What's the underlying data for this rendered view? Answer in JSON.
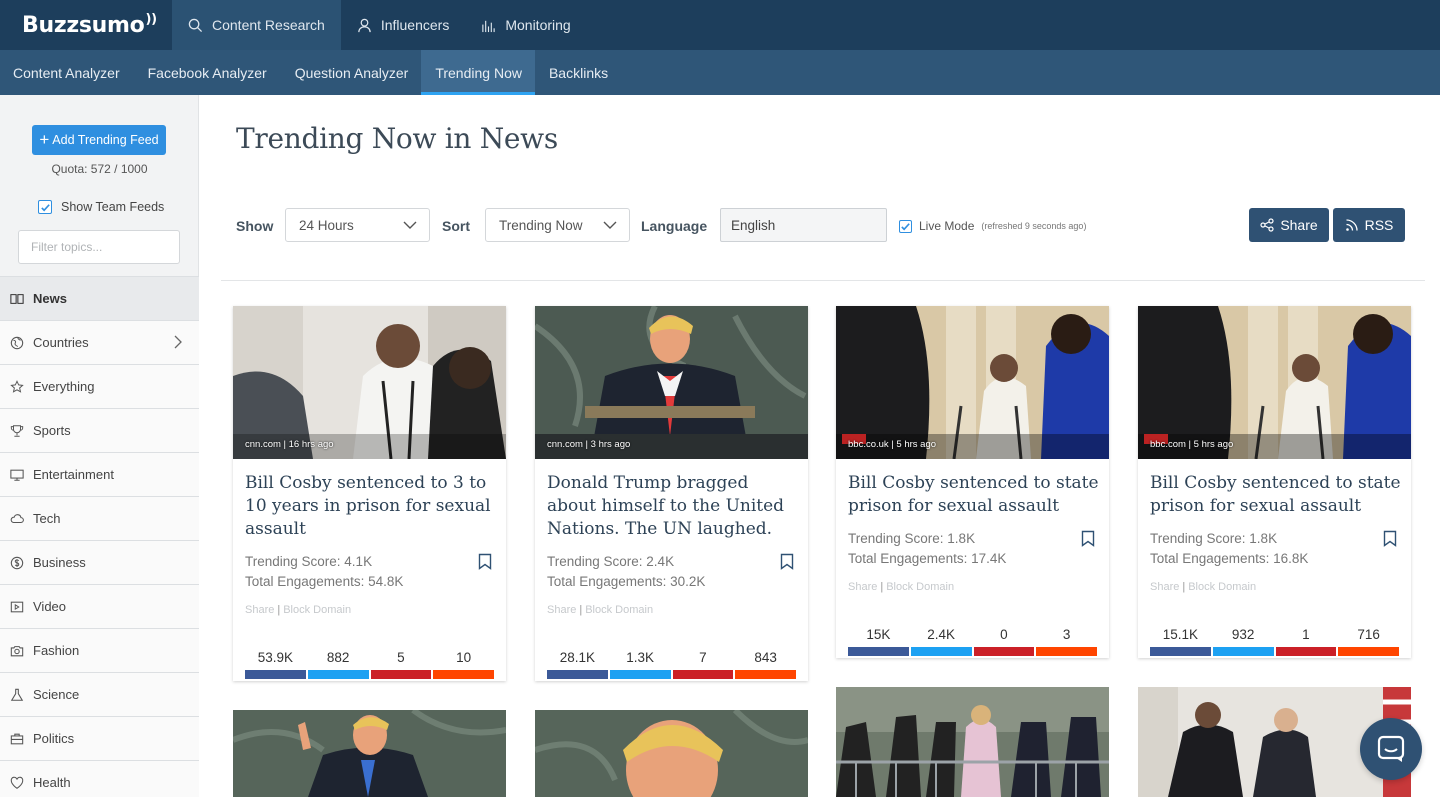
{
  "app": {
    "logo": "Buzzsumo",
    "top_nav": [
      {
        "label": "Content Research",
        "icon": "search-icon",
        "active": true
      },
      {
        "label": "Influencers",
        "icon": "user-icon",
        "active": false
      },
      {
        "label": "Monitoring",
        "icon": "bar-chart-icon",
        "active": false
      }
    ],
    "sub_nav": [
      {
        "label": "Content Analyzer",
        "active": false
      },
      {
        "label": "Facebook Analyzer",
        "active": false
      },
      {
        "label": "Question Analyzer",
        "active": false
      },
      {
        "label": "Trending Now",
        "active": true
      },
      {
        "label": "Backlinks",
        "active": false
      }
    ]
  },
  "sidebar": {
    "add_button": "Add Trending Feed",
    "quota": "Quota: 572 / 1000",
    "show_team_feeds": {
      "label": "Show Team Feeds",
      "checked": true
    },
    "filter_placeholder": "Filter topics...",
    "topics": [
      {
        "label": "News",
        "icon": "book-icon",
        "active": true
      },
      {
        "label": "Countries",
        "icon": "globe-icon",
        "active": false,
        "has_children": true
      },
      {
        "label": "Everything",
        "icon": "star-icon",
        "active": false
      },
      {
        "label": "Sports",
        "icon": "trophy-icon",
        "active": false
      },
      {
        "label": "Entertainment",
        "icon": "monitor-icon",
        "active": false
      },
      {
        "label": "Tech",
        "icon": "cloud-icon",
        "active": false
      },
      {
        "label": "Business",
        "icon": "dollar-icon",
        "active": false
      },
      {
        "label": "Video",
        "icon": "video-icon",
        "active": false
      },
      {
        "label": "Fashion",
        "icon": "camera-icon",
        "active": false
      },
      {
        "label": "Science",
        "icon": "flask-icon",
        "active": false
      },
      {
        "label": "Politics",
        "icon": "briefcase-icon",
        "active": false
      },
      {
        "label": "Health",
        "icon": "heart-icon",
        "active": false
      }
    ]
  },
  "main": {
    "title": "Trending Now in News",
    "filters": {
      "show_label": "Show",
      "show_value": "24 Hours",
      "sort_label": "Sort",
      "sort_value": "Trending Now",
      "language_label": "Language",
      "language_value": "English",
      "live_mode_label": "Live Mode",
      "live_mode_note": "(refreshed 9 seconds ago)",
      "live_mode_checked": true,
      "share_button": "Share",
      "rss_button": "RSS"
    },
    "engagement_colors": [
      "#3b5998",
      "#1da1f2",
      "#cb2027",
      "#ff4500"
    ],
    "cards": [
      {
        "meta": "cnn.com | 16 hrs ago",
        "title": "Bill Cosby sentenced to 3 to 10 years in prison for sexual assault",
        "trending_score": "Trending Score: 4.1K",
        "total_engagements": "Total Engagements: 54.8K",
        "share": "Share",
        "block": "Block Domain",
        "engagements": [
          "53.9K",
          "882",
          "5",
          "10"
        ]
      },
      {
        "meta": "cnn.com | 3 hrs ago",
        "title": "Donald Trump bragged about himself to the United Nations. The UN laughed.",
        "trending_score": "Trending Score: 2.4K",
        "total_engagements": "Total Engagements: 30.2K",
        "share": "Share",
        "block": "Block Domain",
        "engagements": [
          "28.1K",
          "1.3K",
          "7",
          "843"
        ]
      },
      {
        "meta": "bbc.co.uk | 5 hrs ago",
        "title": "Bill Cosby sentenced to state prison for sexual assault",
        "trending_score": "Trending Score: 1.8K",
        "total_engagements": "Total Engagements: 17.4K",
        "share": "Share",
        "block": "Block Domain",
        "engagements": [
          "15K",
          "2.4K",
          "0",
          "3"
        ]
      },
      {
        "meta": "bbc.com | 5 hrs ago",
        "title": "Bill Cosby sentenced to state prison for sexual assault",
        "trending_score": "Trending Score: 1.8K",
        "total_engagements": "Total Engagements: 16.8K",
        "share": "Share",
        "block": "Block Domain",
        "engagements": [
          "15.1K",
          "932",
          "1",
          "716"
        ]
      }
    ]
  }
}
